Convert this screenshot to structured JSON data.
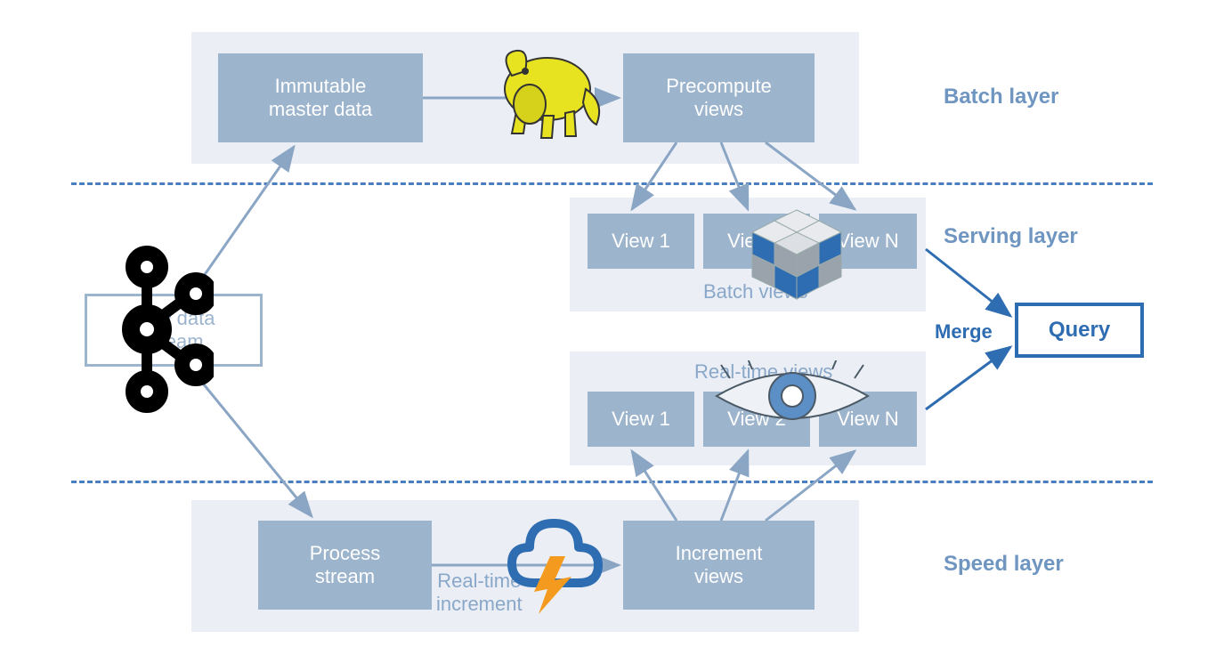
{
  "layers": {
    "batch": "Batch layer",
    "serving": "Serving layer",
    "speed": "Speed layer"
  },
  "boxes": {
    "immutable": "Immutable\nmaster data",
    "precompute": "Precompute\nviews",
    "process": "Process\nstream",
    "increment": "Increment\nviews",
    "new_data": "New data\nstream",
    "view1": "View 1",
    "view2": "View 2",
    "viewN": "View N",
    "query": "Query"
  },
  "bg_labels": {
    "batch_bg": "Batch",
    "batch_views": "Batch views",
    "realtime_views": "Real-time views",
    "realtime_inc": "Real-time\nincrement"
  },
  "merge": "Merge",
  "icons": {
    "kafka": "kafka-icon",
    "hadoop": "hadoop-icon",
    "cube": "cube-icon",
    "cassandra_eye": "eye-icon",
    "storm": "storm-icon"
  },
  "colors": {
    "arrow": "#8ba6c5",
    "dark_blue": "#2f6db2"
  }
}
